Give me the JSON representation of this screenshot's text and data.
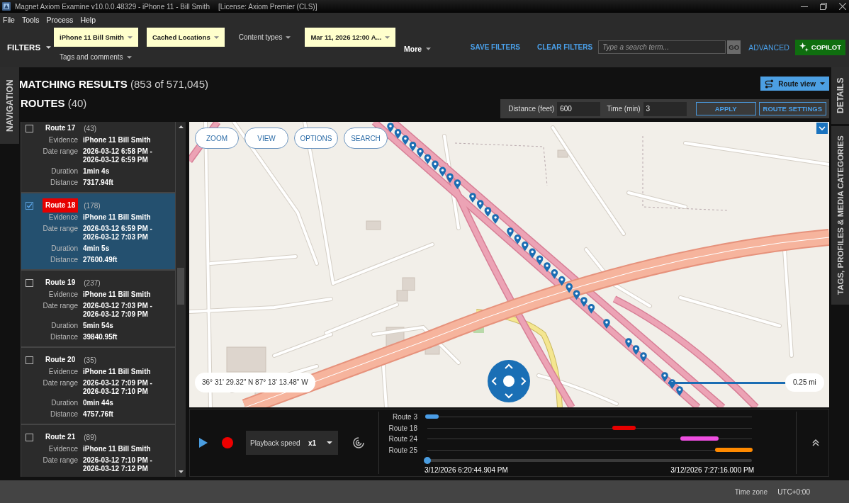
{
  "window": {
    "title": "Magnet Axiom Examine v10.0.0.48329 - iPhone 11 - Bill Smith",
    "license": "[License: Axiom Premier (CLS)]"
  },
  "menu": [
    "File",
    "Tools",
    "Process",
    "Help"
  ],
  "filters": {
    "label": "FILTERS",
    "items": [
      {
        "label": "iPhone 11 Bill Smith",
        "active": true
      },
      {
        "label": "Cached Locations",
        "active": true
      },
      {
        "label": "Content types",
        "active": false
      },
      {
        "label": "Mar 11, 2026 12:00 A...",
        "active": true
      },
      {
        "label": "Tags and comments",
        "active": false
      }
    ],
    "more": "More",
    "actions": [
      "SAVE FILTERS",
      "CLEAR FILTERS"
    ]
  },
  "search": {
    "placeholder": "Type a search term...",
    "button": "GO",
    "advanced": "ADVANCED"
  },
  "copilot": "COPILOT",
  "side_tabs": {
    "left": [
      "NAVIGATION"
    ],
    "right": [
      "DETAILS",
      "TAGS, PROFILES & MEDIA CATEGORIES"
    ]
  },
  "results": {
    "title": "MATCHING RESULTS",
    "count": "(853 of 571,045)"
  },
  "routes_heading": {
    "title": "ROUTES",
    "count": "(40)"
  },
  "route_view": "Route view",
  "route_params": {
    "fields": [
      {
        "label": "Distance (feet)",
        "value": "600"
      },
      {
        "label": "Time (min)",
        "value": "3"
      }
    ],
    "buttons": [
      "APPLY",
      "ROUTE SETTINGS"
    ]
  },
  "routes": [
    {
      "name": "Route 17",
      "count": "(43)",
      "checked": false,
      "selected": false,
      "fields": [
        {
          "label": "Evidence",
          "value": "iPhone 11 Bill Smith"
        },
        {
          "label": "Date range",
          "value": "2026-03-12 6:58 PM - 2026-03-12 6:59 PM"
        },
        {
          "label": "Duration",
          "value": "1min 4s"
        },
        {
          "label": "Distance",
          "value": "7317.94ft"
        }
      ]
    },
    {
      "name": "Route 18",
      "count": "(178)",
      "checked": true,
      "selected": true,
      "color": "#e60000",
      "fields": [
        {
          "label": "Evidence",
          "value": "iPhone 11 Bill Smith"
        },
        {
          "label": "Date range",
          "value": "2026-03-12 6:59 PM - 2026-03-12 7:03 PM"
        },
        {
          "label": "Duration",
          "value": "4min 5s"
        },
        {
          "label": "Distance",
          "value": "27600.49ft"
        }
      ]
    },
    {
      "name": "Route 19",
      "count": "(237)",
      "checked": false,
      "selected": false,
      "fields": [
        {
          "label": "Evidence",
          "value": "iPhone 11 Bill Smith"
        },
        {
          "label": "Date range",
          "value": "2026-03-12 7:03 PM - 2026-03-12 7:09 PM"
        },
        {
          "label": "Duration",
          "value": "5min 54s"
        },
        {
          "label": "Distance",
          "value": "39840.95ft"
        }
      ]
    },
    {
      "name": "Route 20",
      "count": "(35)",
      "checked": false,
      "selected": false,
      "fields": [
        {
          "label": "Evidence",
          "value": "iPhone 11 Bill Smith"
        },
        {
          "label": "Date range",
          "value": "2026-03-12 7:09 PM - 2026-03-12 7:10 PM"
        },
        {
          "label": "Duration",
          "value": "0min 44s"
        },
        {
          "label": "Distance",
          "value": "4757.76ft"
        }
      ]
    },
    {
      "name": "Route 21",
      "count": "(89)",
      "checked": false,
      "selected": false,
      "fields": [
        {
          "label": "Evidence",
          "value": "iPhone 11 Bill Smith"
        },
        {
          "label": "Date range",
          "value": "2026-03-12 7:10 PM - 2026-03-12 7:12 PM"
        }
      ]
    }
  ],
  "map": {
    "buttons": [
      "ZOOM",
      "VIEW",
      "OPTIONS",
      "SEARCH"
    ],
    "coordinates": "36° 31' 29.32\" N 87° 13' 13.48\" W",
    "scale": "0.25 mi"
  },
  "playback": {
    "label": "Playback speed",
    "speed": "x1"
  },
  "timeline": {
    "tracks": [
      {
        "label": "Route 3",
        "color": "#4a9de6"
      },
      {
        "label": "Route 18",
        "color": "#e60000"
      },
      {
        "label": "Route 24",
        "color": "#ee4ee0"
      },
      {
        "label": "Route 25",
        "color": "#ff8a00"
      }
    ],
    "start": "3/12/2026 6:20:44.904 PM",
    "end": "3/12/2026 7:27:16.000 PM",
    "playhead": {
      "level": 0
    }
  },
  "status_bar": {
    "label": "Time zone",
    "value": "UTC+0:00"
  }
}
